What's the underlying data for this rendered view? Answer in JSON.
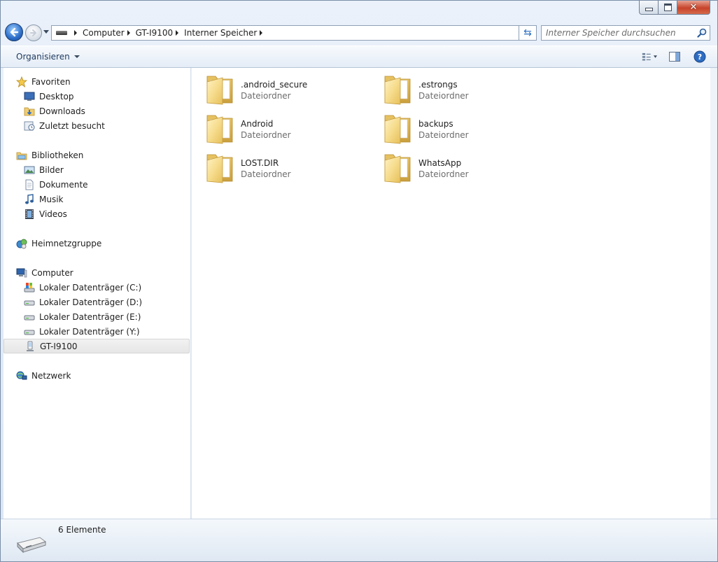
{
  "window": {
    "close_glyph": "✕"
  },
  "nav": {
    "refresh_glyph": "⇆",
    "breadcrumbs": [
      "Computer",
      "GT-I9100",
      "Interner Speicher"
    ]
  },
  "search": {
    "placeholder": "Interner Speicher durchsuchen",
    "value": ""
  },
  "toolbar": {
    "organize_label": "Organisieren"
  },
  "sidebar": {
    "favorites": {
      "label": "Favoriten",
      "items": [
        "Desktop",
        "Downloads",
        "Zuletzt besucht"
      ]
    },
    "libraries": {
      "label": "Bibliotheken",
      "items": [
        "Bilder",
        "Dokumente",
        "Musik",
        "Videos"
      ]
    },
    "homegroup": {
      "label": "Heimnetzgruppe"
    },
    "computer": {
      "label": "Computer",
      "items": [
        "Lokaler Datenträger (C:)",
        "Lokaler Datenträger (D:)",
        "Lokaler Datenträger (E:)",
        "Lokaler Datenträger (Y:)",
        "GT-I9100"
      ]
    },
    "network": {
      "label": "Netzwerk"
    }
  },
  "files": [
    {
      "name": ".android_secure",
      "type": "Dateiordner"
    },
    {
      "name": ".estrongs",
      "type": "Dateiordner"
    },
    {
      "name": "Android",
      "type": "Dateiordner"
    },
    {
      "name": "backups",
      "type": "Dateiordner"
    },
    {
      "name": "LOST.DIR",
      "type": "Dateiordner"
    },
    {
      "name": "WhatsApp",
      "type": "Dateiordner"
    }
  ],
  "status": {
    "item_count": "6 Elemente"
  },
  "colors": {
    "accent": "#2a6cc8",
    "selection": "#e6e6e6",
    "folder": "#f3d27a"
  }
}
